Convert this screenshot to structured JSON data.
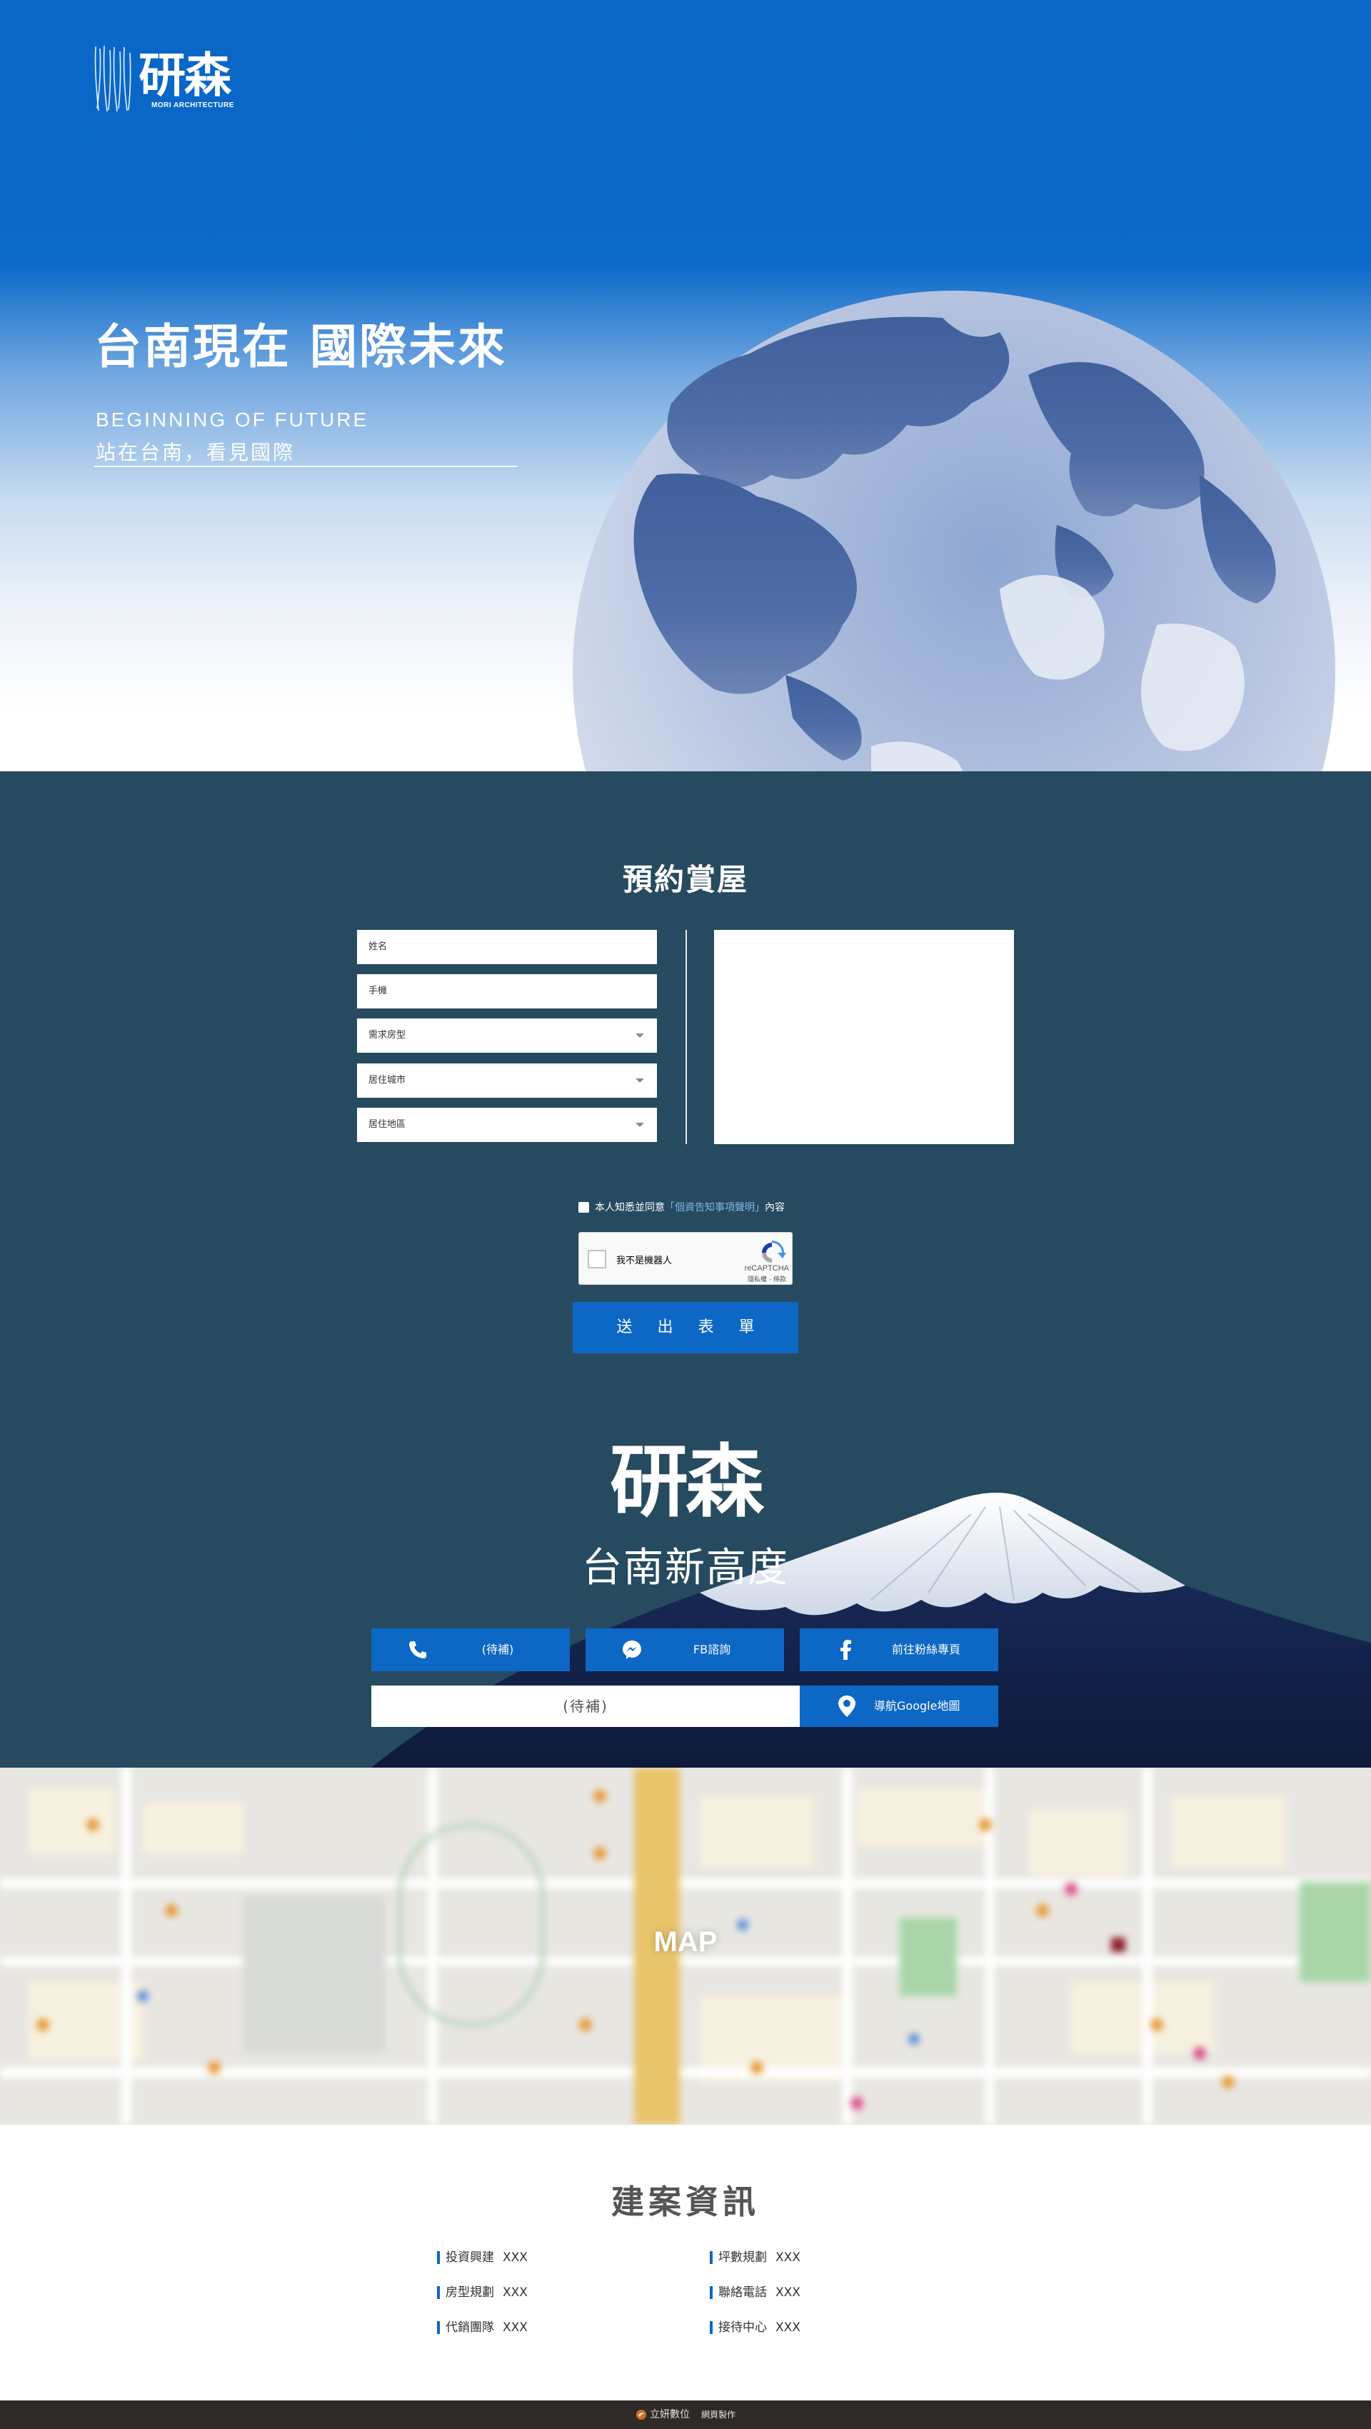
{
  "brand": {
    "logo_text": "研森",
    "logo_sub": "MORI ARCHITECTURE"
  },
  "hero": {
    "title": "台南現在 國際未來",
    "subtitle_en": "BEGINNING OF FUTURE",
    "subtitle_zh": "站在台南，看見國際"
  },
  "form": {
    "title": "預約賞屋",
    "fields": {
      "name": "姓名",
      "phone": "手機",
      "room_type": "需求房型",
      "city": "居住城市",
      "district": "居住地區"
    },
    "agree_prefix": "本人知悉並同意",
    "agree_link": "「個資告知事項聲明」",
    "agree_suffix": "內容",
    "captcha_label": "我不是機器人",
    "captcha_brand": "reCAPTCHA",
    "captcha_terms": "隱私權 - 條款",
    "submit_label": "送 出 表 單"
  },
  "contact": {
    "brand_big": "研森",
    "tagline": "台南新高度",
    "phone_label": "(待補)",
    "fb_chat_label": "FB諮詢",
    "fan_page_label": "前往粉絲專頁",
    "address": "(待補)",
    "nav_label": "導航Google地圖"
  },
  "map": {
    "label": "MAP"
  },
  "info": {
    "title": "建案資訊",
    "items": [
      {
        "label": "投資興建",
        "value": "XXX"
      },
      {
        "label": "坪數規劃",
        "value": "XXX"
      },
      {
        "label": "房型規劃",
        "value": "XXX"
      },
      {
        "label": "聯絡電話",
        "value": "XXX"
      },
      {
        "label": "代銷團隊",
        "value": "XXX"
      },
      {
        "label": "接待中心",
        "value": "XXX"
      }
    ]
  },
  "footer": {
    "company": "立妍數位",
    "made": "網頁製作"
  },
  "colors": {
    "primary": "#0d67c4",
    "dark_section": "#264a5f",
    "footer": "#2f2a28",
    "info_accent": "#0d67c4"
  },
  "icons": [
    "phone-icon",
    "messenger-icon",
    "facebook-icon",
    "map-pin-icon",
    "dropdown-caret-icon",
    "recaptcha-icon"
  ]
}
